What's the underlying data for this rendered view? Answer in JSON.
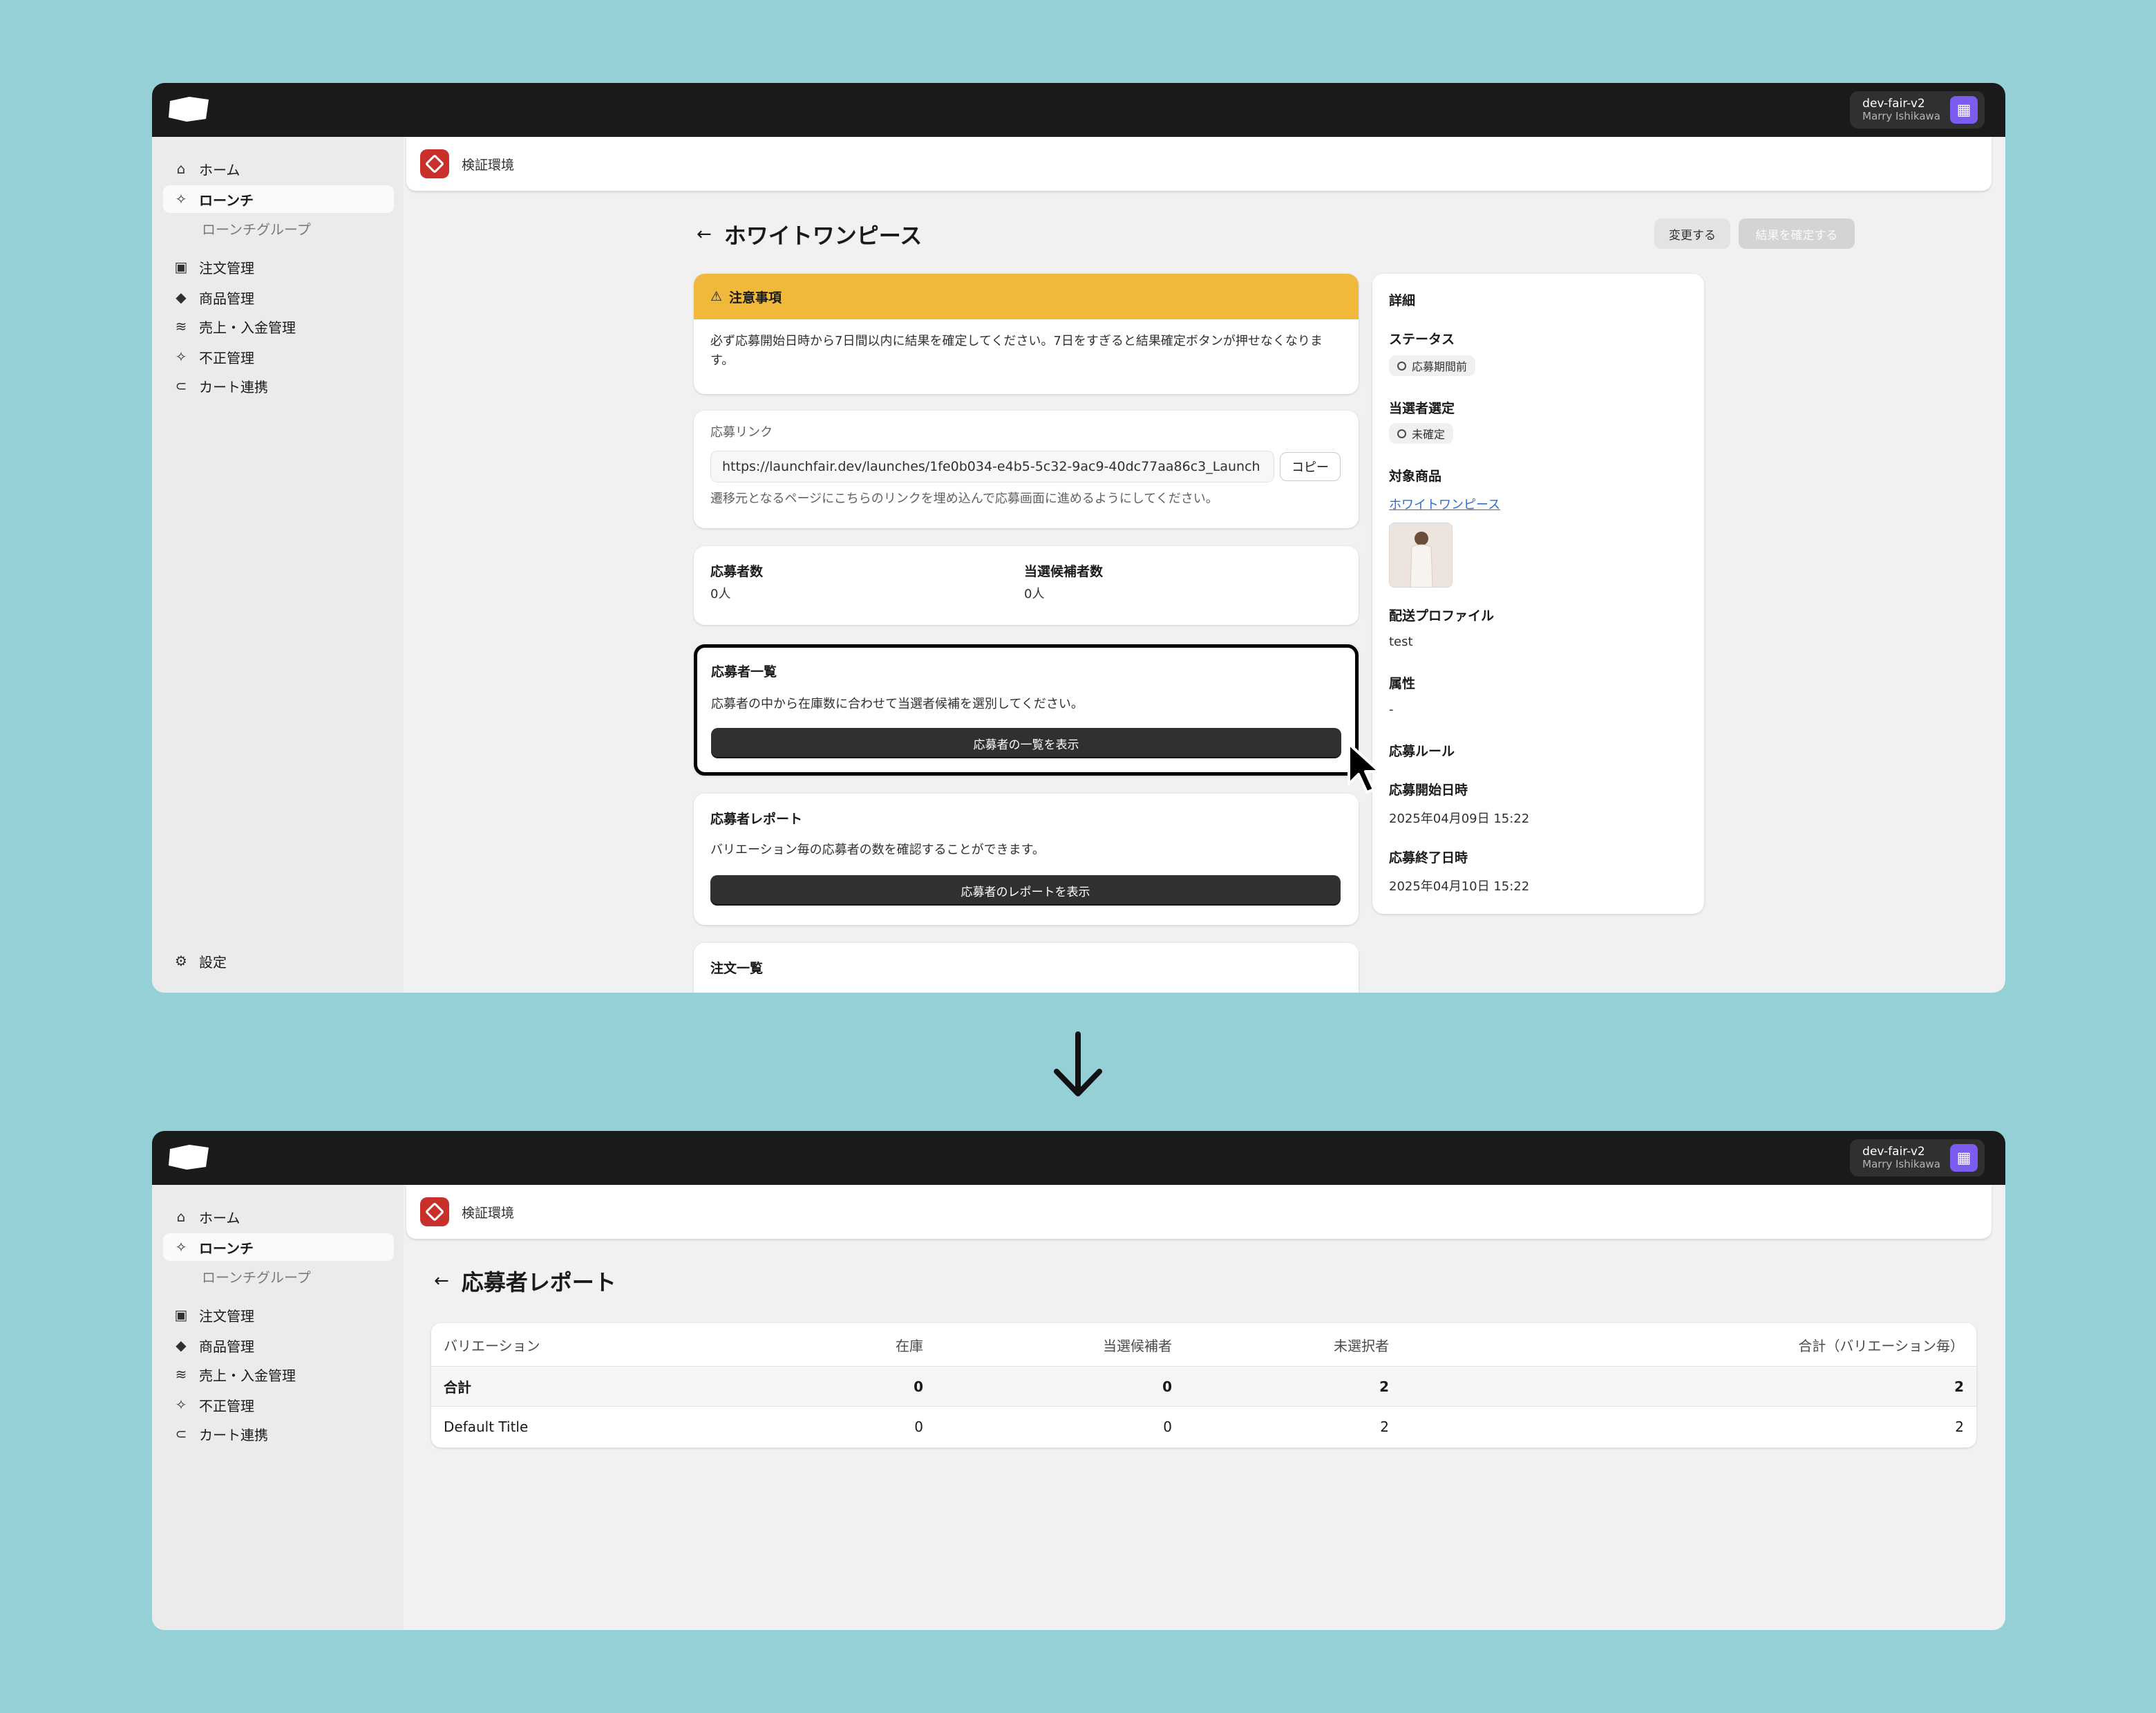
{
  "topbar": {
    "store_name": "dev-fair-v2",
    "user_name": "Marry Ishikawa",
    "badge_icon": "building-icon"
  },
  "sidebar": {
    "items": [
      {
        "label": "ホーム",
        "icon": "home-icon"
      },
      {
        "label": "ローンチ",
        "icon": "sparkle-icon"
      },
      {
        "label": "ローンチグループ"
      },
      {
        "label": "注文管理",
        "icon": "inbox-icon"
      },
      {
        "label": "商品管理",
        "icon": "tag-icon"
      },
      {
        "label": "売上・入金管理",
        "icon": "cash-icon"
      },
      {
        "label": "不正管理",
        "icon": "sparkle-icon"
      },
      {
        "label": "カート連携",
        "icon": "link-icon"
      }
    ],
    "settings_label": "設定"
  },
  "env": {
    "label": "検証環境"
  },
  "launch_page": {
    "title": "ホワイトワンピース",
    "change_button": "変更する",
    "confirm_button": "結果を確定する",
    "notice": {
      "title": "注意事項",
      "text": "必ず応募開始日時から7日間以内に結果を確定してください。7日をすぎると結果確定ボタンが押せなくなります。"
    },
    "apply_link": {
      "label": "応募リンク",
      "url": "https://launchfair.dev/launches/1fe0b034-e4b5-5c32-9ac9-40dc77aa86c3_Launch",
      "copy_button": "コピー",
      "help": "遷移元となるページにこちらのリンクを埋め込んで応募画面に進めるようにしてください。"
    },
    "stats": {
      "applicants_label": "応募者数",
      "applicants_value": "0人",
      "candidates_label": "当選候補者数",
      "candidates_value": "0人"
    },
    "applicant_list": {
      "title": "応募者一覧",
      "text": "応募者の中から在庫数に合わせて当選者候補を選別してください。",
      "button": "応募者の一覧を表示"
    },
    "applicant_report": {
      "title": "応募者レポート",
      "text": "バリエーション毎の応募者の数を確認することができます。",
      "button": "応募者のレポートを表示"
    },
    "orders": {
      "title": "注文一覧"
    },
    "details": {
      "title": "詳細",
      "status_label": "ステータス",
      "status_value": "応募期間前",
      "winner_label": "当選者選定",
      "winner_value": "未確定",
      "product_label": "対象商品",
      "product_value": "ホワイトワンピース",
      "shipping_label": "配送プロファイル",
      "shipping_value": "test",
      "attribute_label": "属性",
      "attribute_value": "-",
      "rule_label": "応募ルール",
      "start_label": "応募開始日時",
      "start_value": "2025年04月09日 15:22",
      "end_label": "応募終了日時",
      "end_value": "2025年04月10日 15:22"
    }
  },
  "report_page": {
    "title": "応募者レポート",
    "columns": [
      "バリエーション",
      "在庫",
      "当選候補者",
      "未選択者",
      "合計（バリエーション毎）"
    ],
    "rows": [
      [
        "合計",
        "0",
        "0",
        "2",
        "2"
      ],
      [
        "Default Title",
        "0",
        "0",
        "2",
        "2"
      ]
    ]
  },
  "colors": {
    "topbar": "#1a1a1a",
    "warning": "#f1b93c",
    "env_badge": "#c9302c",
    "account_badge": "#7c5cf0",
    "link": "#2c6ecb",
    "background": "#94d0d6"
  }
}
